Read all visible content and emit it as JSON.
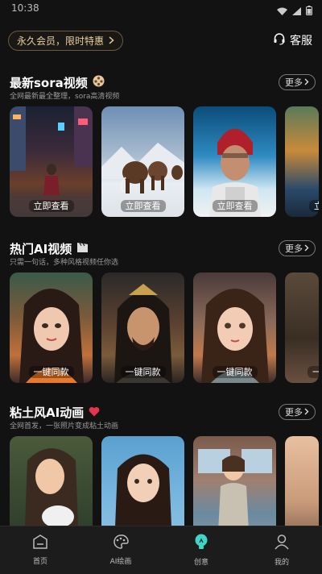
{
  "status": {
    "time": "10:38"
  },
  "header": {
    "vip_label": "永久会员，限时特惠",
    "service_label": "客服"
  },
  "sections": [
    {
      "title": "最新sora视频",
      "subtitle": "全网最新最全整理，sora高清视频",
      "more_label": "更多",
      "cards": [
        {
          "label": "立即查看"
        },
        {
          "label": "立即查看"
        },
        {
          "label": "立即查看"
        },
        {
          "label": "立"
        }
      ]
    },
    {
      "title": "热门AI视频",
      "subtitle": "只需一句话，多种风格视频任你选",
      "more_label": "更多",
      "cards": [
        {
          "label": "一键同款"
        },
        {
          "label": "一键同款"
        },
        {
          "label": "一键同款"
        },
        {
          "label": "一"
        }
      ]
    },
    {
      "title": "粘土风AI动画",
      "subtitle": "全网首发，一张照片变成粘土动画",
      "more_label": "更多",
      "cards": [
        {
          "label": ""
        },
        {
          "label": ""
        },
        {
          "label": ""
        },
        {
          "label": ""
        }
      ]
    }
  ],
  "tabs": [
    {
      "label": "首页",
      "icon": "home-icon"
    },
    {
      "label": "AI绘画",
      "icon": "palette-icon"
    },
    {
      "label": "创意",
      "icon": "bulb-icon",
      "active": true
    },
    {
      "label": "我的",
      "icon": "user-icon"
    }
  ],
  "colors": {
    "accent": "#3fd6c8",
    "vip_gold": "#e8cfa0",
    "background": "#121212"
  }
}
